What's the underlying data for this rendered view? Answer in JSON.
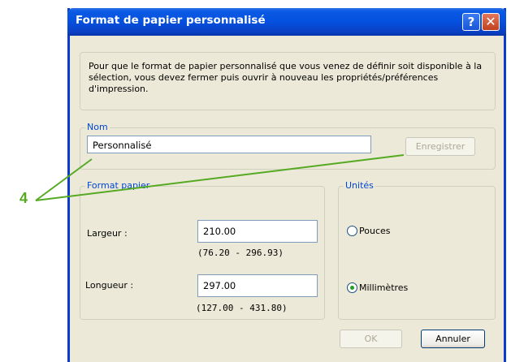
{
  "window": {
    "title": "Format de papier personnalisé",
    "help_glyph": "?",
    "close_glyph": "✕"
  },
  "info": {
    "text": "Pour que le format de papier personnalisé que vous venez de définir soit disponible à la sélection, vous devez fermer puis ouvrir à nouveau les propriétés/préférences d'impression."
  },
  "nom": {
    "legend": "Nom",
    "value": "Personnalisé",
    "save_label": "Enregistrer"
  },
  "format_papier": {
    "legend": "Format papier",
    "width_label": "Largeur :",
    "width_value": "210.00",
    "width_range": "(76.20 - 296.93)",
    "length_label": "Longueur :",
    "length_value": "297.00",
    "length_range": "(127.00 - 431.80)"
  },
  "units": {
    "legend": "Unités",
    "options": [
      {
        "label": "Pouces",
        "selected": false
      },
      {
        "label": "Millimètres",
        "selected": true
      }
    ]
  },
  "footer": {
    "ok_label": "OK",
    "cancel_label": "Annuler"
  },
  "callout": {
    "number": "4",
    "color": "#55aa22"
  },
  "colors": {
    "titlebar": "#0550df",
    "dialog_bg": "#ece9d8",
    "group_legend": "#0046d5",
    "radio_dot": "#21a121"
  }
}
